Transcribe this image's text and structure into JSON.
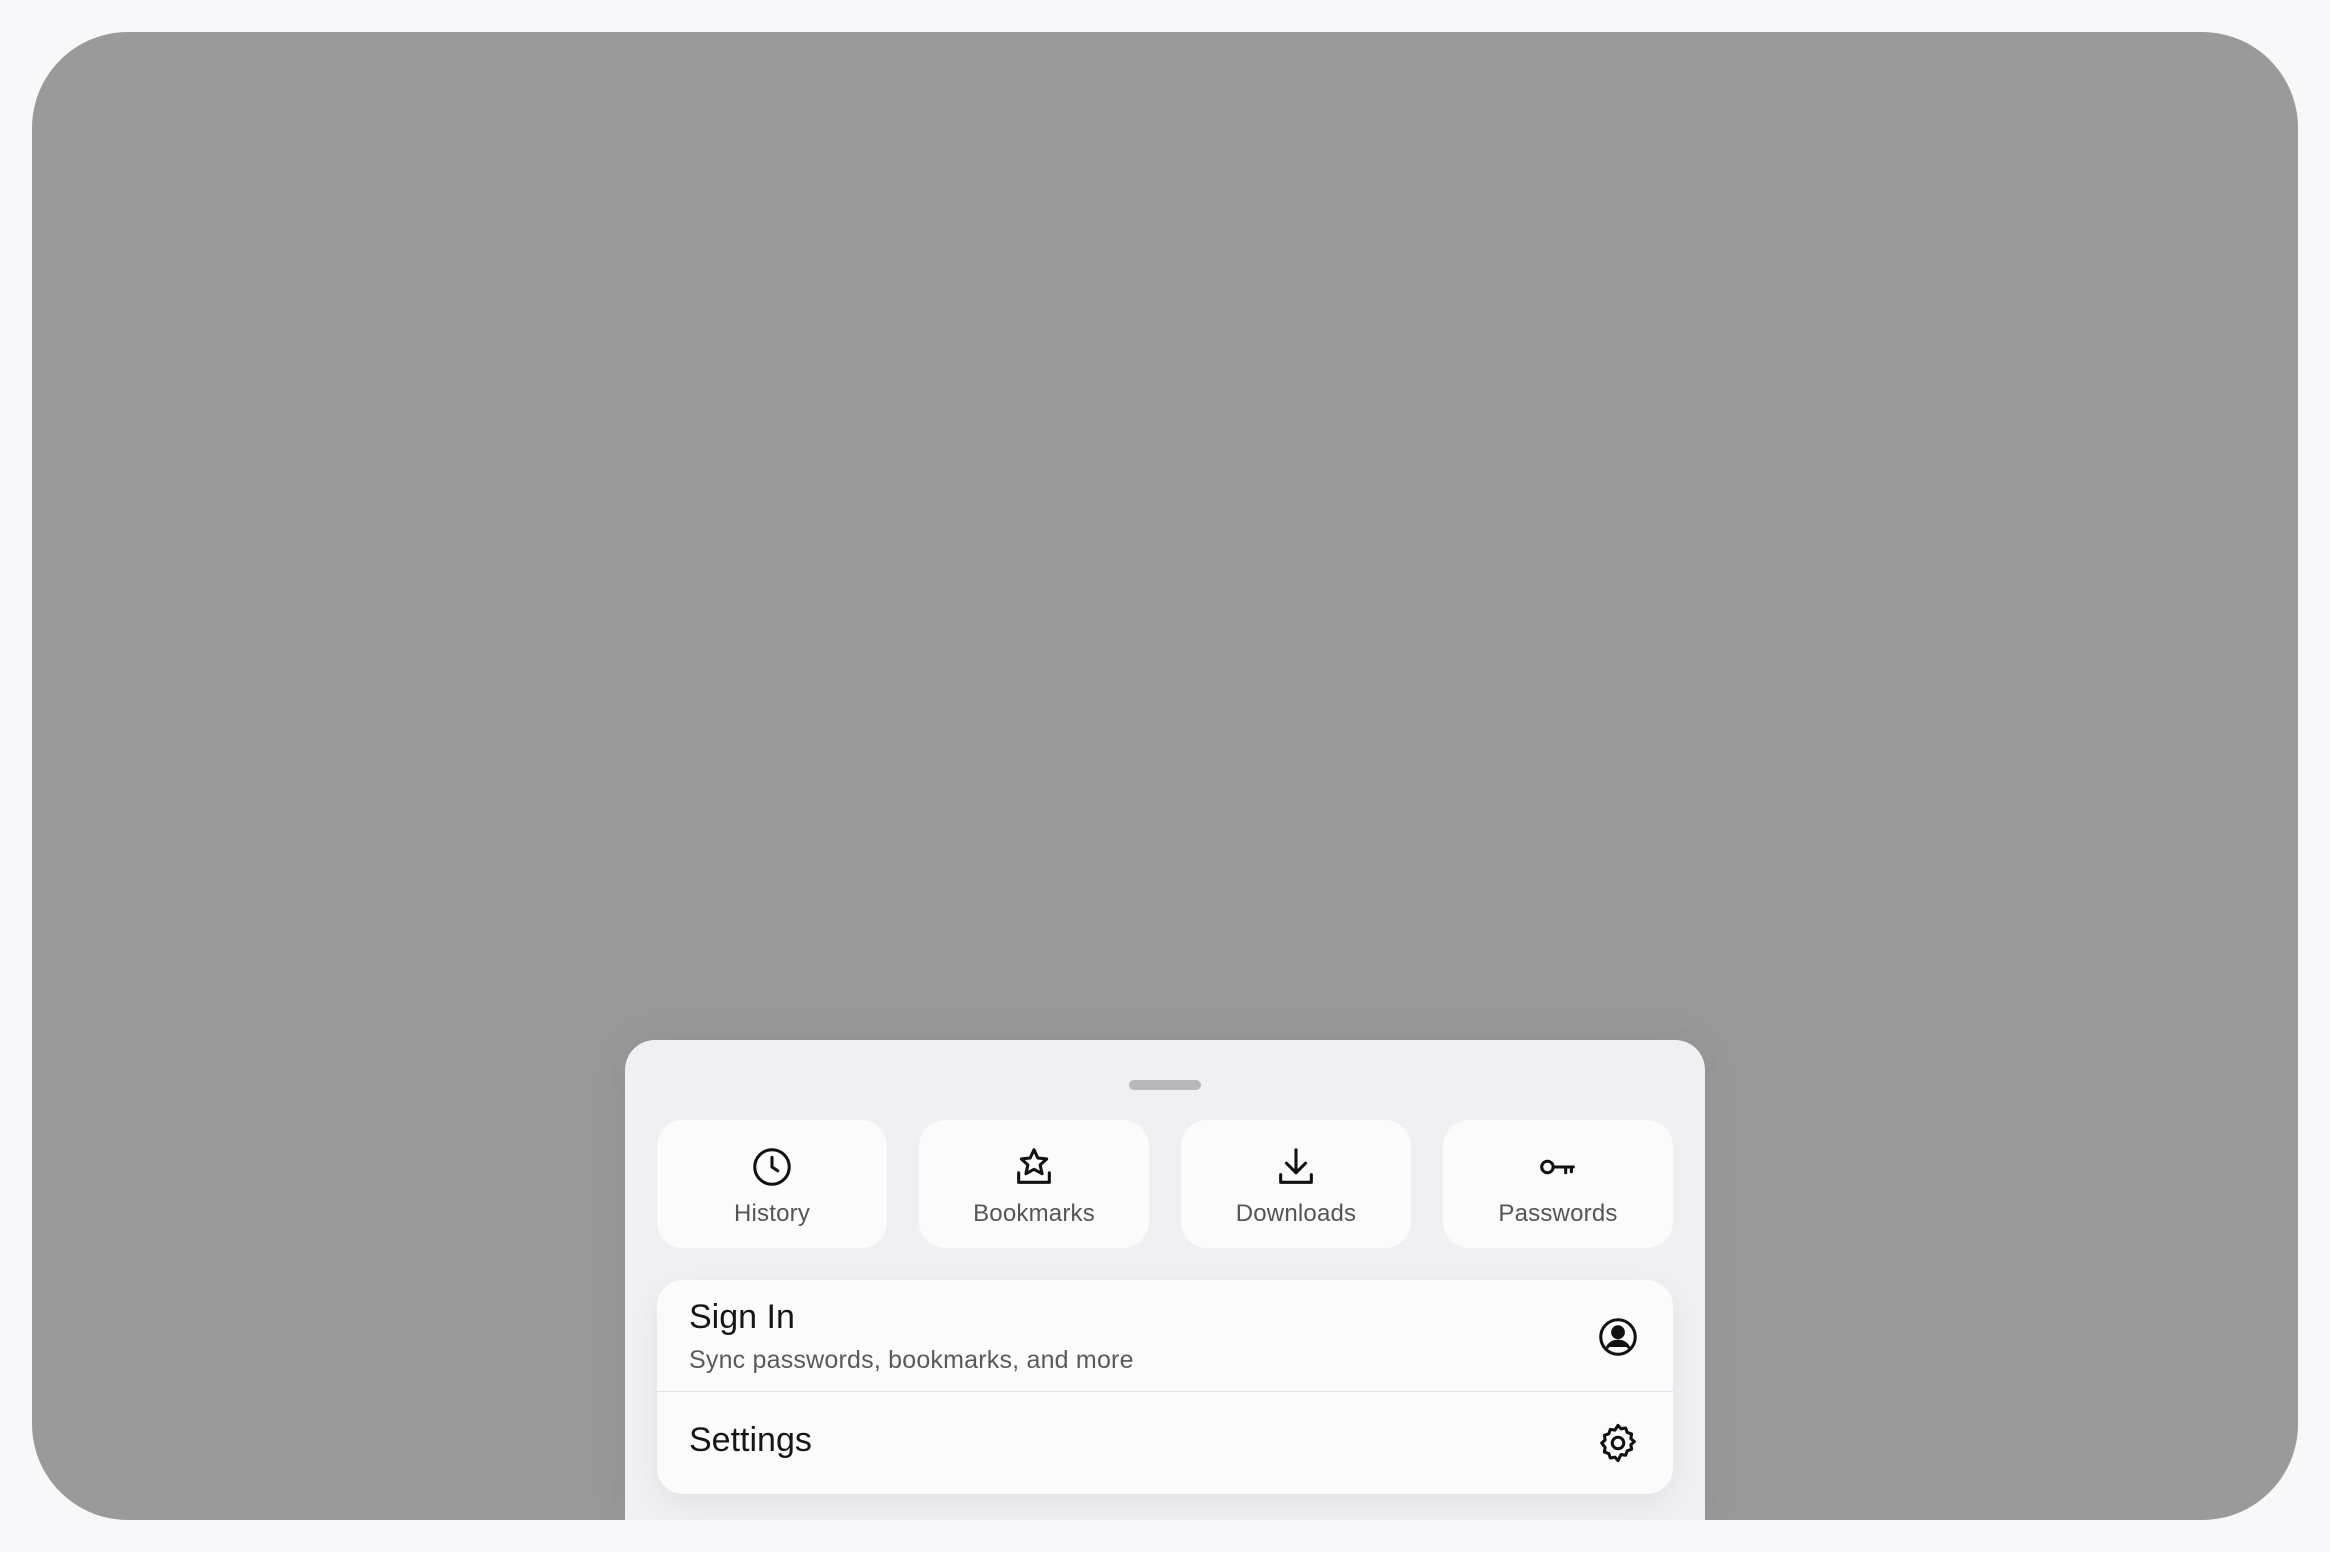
{
  "menu": {
    "quick_actions": [
      {
        "label": "History",
        "icon": "clock-icon"
      },
      {
        "label": "Bookmarks",
        "icon": "star-tray-icon"
      },
      {
        "label": "Downloads",
        "icon": "download-icon"
      },
      {
        "label": "Passwords",
        "icon": "key-icon"
      }
    ],
    "sign_in": {
      "title": "Sign In",
      "subtitle": "Sync passwords, bookmarks, and more",
      "icon": "account-circle-icon"
    },
    "settings": {
      "title": "Settings",
      "icon": "gear-icon"
    }
  },
  "colors": {
    "backdrop": "#9a9a9a",
    "sheet": "#efeff4",
    "card": "#fbfbfb",
    "text_primary": "#161616",
    "text_secondary": "#5a5a5e"
  }
}
